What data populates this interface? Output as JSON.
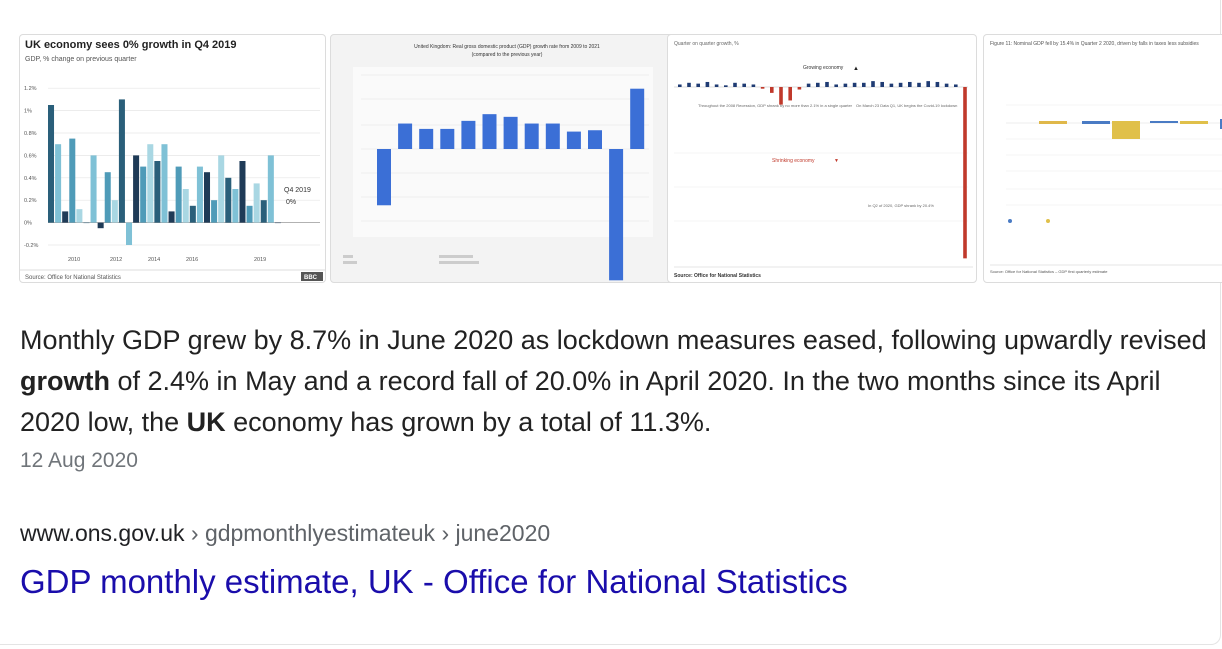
{
  "thumbnails": {
    "chart1": {
      "title": "UK economy sees 0% growth in Q4 2019",
      "subtitle": "GDP, % change on previous quarter",
      "y_ticks": [
        "1.2%",
        "1%",
        "0.8%",
        "0.6%",
        "0.4%",
        "0.2%",
        "0%",
        "-0.2%"
      ],
      "x_ticks": [
        "2010",
        "2012",
        "2014",
        "2016",
        "2019"
      ],
      "annotation_line1": "Q4 2019",
      "annotation_line2": "0%",
      "source": "Source: Office for National Statistics",
      "badge": "BBC"
    },
    "chart2": {
      "title_line1": "United Kingdom: Real gross domestic product (GDP) growth rate from 2009 to 2021",
      "title_line2": "(compared to the previous year)"
    },
    "chart3": {
      "top_label": "Quarter on quarter growth, %",
      "growing_label": "Growing economy",
      "note_left": "Throughout the 2008 Recession, GDP shrank by no more than 2.1% in a single quarter",
      "note_right": "On March 23 Data Q1, UK begins the Covid-19 lockdown",
      "shrinking_label": "Shrinking economy",
      "bottom_note": "In Q2 of 2020, GDP shrank by 20.4%",
      "source": "Source: Office for National Statistics"
    },
    "chart4": {
      "title": "Figure 11: Nominal GDP fell by 15.4% in Quarter 2 2020, driven by falls in taxes less subsidies",
      "source": "Source: Office for National Statistics – GDP first quarterly estimate"
    }
  },
  "chart_data": [
    {
      "type": "bar",
      "title": "UK economy sees 0% growth in Q4 2019",
      "ylabel": "GDP, % change on previous quarter",
      "ylim": [
        -0.2,
        1.3
      ],
      "values": [
        1.05,
        0.7,
        0.1,
        0.75,
        0.12,
        0.0,
        0.6,
        -0.05,
        0.45,
        0.2,
        1.1,
        -0.2,
        0.6,
        0.5,
        0.7,
        0.55,
        0.7,
        0.1,
        0.5,
        0.3,
        0.15,
        0.5,
        0.45,
        0.2,
        0.6,
        0.4,
        0.3,
        0.55,
        0.15,
        0.35,
        0.2,
        0.6,
        0.0
      ]
    },
    {
      "type": "bar",
      "title": "United Kingdom: Real gross domestic product (GDP) growth rate from 2009 to 2021",
      "values": [
        -4.2,
        1.9,
        1.5,
        1.5,
        2.1,
        2.6,
        2.4,
        1.9,
        1.9,
        1.3,
        1.4,
        -9.8,
        4.5
      ]
    },
    {
      "type": "bar",
      "title": "Quarter on quarter growth, %",
      "values": [
        0.3,
        0.5,
        0.4,
        0.6,
        0.3,
        0.2,
        0.5,
        0.4,
        0.3,
        -0.2,
        -0.7,
        -2.1,
        -1.6,
        -0.3,
        0.4,
        0.5,
        0.6,
        0.3,
        0.4,
        0.5,
        0.5,
        0.7,
        0.6,
        0.4,
        0.5,
        0.6,
        0.5,
        0.7,
        0.6,
        0.4,
        0.3,
        -20.4
      ]
    }
  ],
  "snippet": {
    "part1": "Monthly GDP grew by 8.7% in June 2020 as lockdown measures eased, following upwardly revised ",
    "bold1": "growth",
    "part2": " of 2.4% in May and a record fall of 20.0% in April 2020. In the two months since its April 2020 low, the ",
    "bold2": "UK",
    "part3": " economy has grown by a total of 11.3%."
  },
  "date": "12 Aug 2020",
  "breadcrumb": {
    "domain": "www.ons.gov.uk",
    "separator": "›",
    "path1": "gdpmonthlyestimateuk",
    "path2": "june2020"
  },
  "result_title": "GDP monthly estimate, UK - Office for National Statistics",
  "colors": {
    "link": "#1a0dab",
    "snippet_text": "#222222",
    "muted": "#70757a",
    "bar_blue": "#3b6fd6",
    "bar_red": "#c0392b"
  }
}
